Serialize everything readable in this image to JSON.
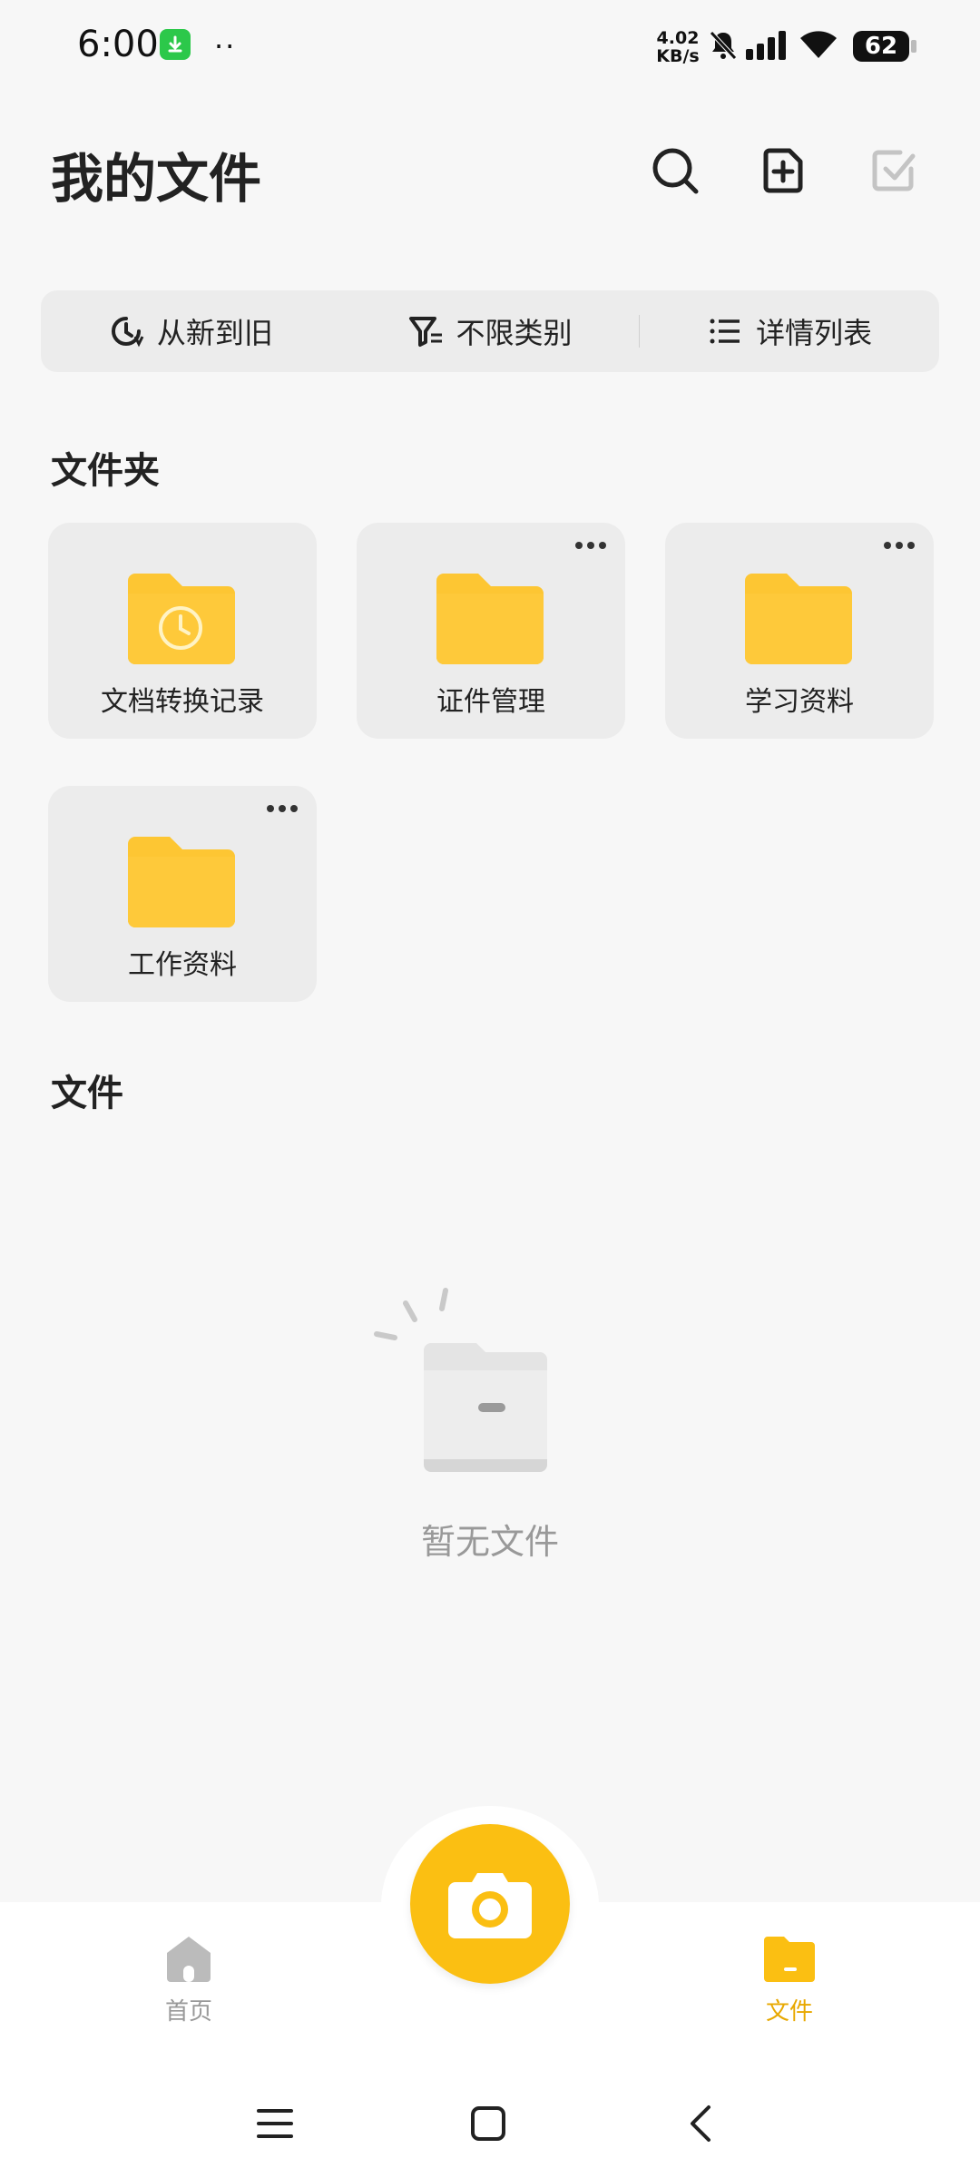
{
  "status_bar": {
    "time": "6:00",
    "notification_dots": "··",
    "net_speed_value": "4.02",
    "net_speed_unit": "KB/s",
    "battery": "62",
    "icons": [
      "download-badge-icon",
      "bell-muted-icon",
      "signal-icon",
      "wifi-icon",
      "battery-icon"
    ]
  },
  "header": {
    "title": "我的文件",
    "actions": [
      "search-icon",
      "add-folder-icon",
      "select-check-icon"
    ]
  },
  "filters": [
    {
      "label": "从新到旧",
      "icon": "sort-time-icon"
    },
    {
      "label": "不限类别",
      "icon": "filter-icon"
    },
    {
      "label": "详情列表",
      "icon": "list-view-icon"
    }
  ],
  "folders_section": {
    "title": "文件夹",
    "items": [
      {
        "name": "文档转换记录",
        "icon": "folder-clock-icon",
        "has_more": false
      },
      {
        "name": "证件管理",
        "icon": "folder-icon",
        "has_more": true
      },
      {
        "name": "学习资料",
        "icon": "folder-icon",
        "has_more": true
      },
      {
        "name": "工作资料",
        "icon": "folder-icon",
        "has_more": true
      }
    ]
  },
  "files_section": {
    "title": "文件",
    "empty_text": "暂无文件"
  },
  "bottom_nav": {
    "home_label": "首页",
    "files_label": "文件",
    "active": "files"
  },
  "colors": {
    "accent": "#fbbf12",
    "folder_yellow": "#fdc633",
    "background": "#f7f7f7",
    "card": "#ececec",
    "inactive": "#bbbbbb"
  }
}
